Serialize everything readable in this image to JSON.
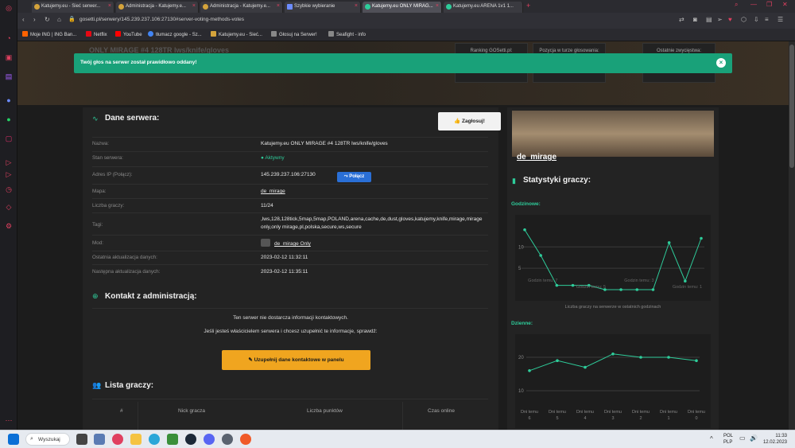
{
  "tabs": [
    {
      "label": "Katujemy.eu - Sieć serwer...",
      "active": false
    },
    {
      "label": "Administracja - Katujemy.e...",
      "active": false
    },
    {
      "label": "Administracja - Katujemy.e...",
      "active": false
    },
    {
      "label": "Szybkie wybieranie",
      "active": false
    },
    {
      "label": "Katujemy.eu ONLY MIRAG...",
      "active": true
    },
    {
      "label": "Katujemy.eu ARENA 1v1 1...",
      "active": false
    }
  ],
  "address": {
    "url": "gosetti.pl/serwery/145.239.237.106:27130#server-voting-methods-votes"
  },
  "bookmarks": [
    {
      "label": "Moje ING | ING Ban...",
      "color": "#ff6200"
    },
    {
      "label": "Netflix",
      "color": "#e50914"
    },
    {
      "label": "YouTube",
      "color": "#ff0000"
    },
    {
      "label": "tłumacz google - Sz...",
      "color": "#4285f4"
    },
    {
      "label": "Katujemy.eu - Sieć...",
      "color": "#d4a33b"
    },
    {
      "label": "Głosuj na Serwer!",
      "color": "#888888"
    },
    {
      "label": "Seafight - info",
      "color": "#888888"
    }
  ],
  "hero": {
    "title": "ONLY MIRAGE #4 128TR lws/knife/gloves",
    "boxes": [
      "Ranking GOSetti.pl:",
      "Pozycja w turze głosowania:",
      "Ostatnie zwycięstwa:"
    ]
  },
  "alert": {
    "text": "Twój głos na serwer został prawidłowo oddany!"
  },
  "server": {
    "section_title": "Dane serwera:",
    "vote_label": "Zagłosuj!",
    "connect_label": "Połącz",
    "rows": [
      {
        "label": "Nazwa:",
        "value": "Katujemy.eu ONLY MIRAGE #4 128TR lws/knife/gloves"
      },
      {
        "label": "Stan serwera:",
        "value": "Aktywny"
      },
      {
        "label": "Adres IP (Połącz):",
        "value": "145.239.237.106:27130"
      },
      {
        "label": "Mapa:",
        "value": "de_mirage"
      },
      {
        "label": "Liczba graczy:",
        "value": "11/24"
      },
      {
        "label": "Tagi:",
        "value": ",lws,128,128tick,5map,5map,POLAND,arena,cache,de,dust,gloves,katujemy,knife,mirage,mirage only,only mirage,pl,polska,secure,ws,secure"
      },
      {
        "label": "Mod:",
        "value": "de_mirage Only"
      },
      {
        "label": "Ostatnia aktualizacja danych:",
        "value": "2023-02-12 11:32:11"
      },
      {
        "label": "Następna aktualizacja danych:",
        "value": "2023-02-12 11:35:11"
      }
    ]
  },
  "contact": {
    "section_title": "Kontakt z administracją:",
    "line1": "Ten serwer nie dostarcza informacji kontaktowych.",
    "line2": "Jeśli jesteś właścicielem serwera i chcesz uzupełnić te informacje, sprawdź:",
    "button": "Uzupełnij dane kontaktowe w panelu"
  },
  "players": {
    "section_title": "Lista graczy:",
    "columns": [
      "#",
      "Nick gracza",
      "Liczba punktów",
      "Czas online"
    ]
  },
  "sidebar": {
    "map_name": "de_mirage",
    "stats_title": "Statystyki graczy:",
    "hourly_label": "Godzinowe:",
    "hourly_caption": "Liczba graczy na serwerze w ostatnich godzinach",
    "daily_label": "Dzienne:"
  },
  "chart_data": [
    {
      "type": "line",
      "title": "Godzinowe:",
      "x": [
        "",
        "",
        "",
        "",
        "",
        "",
        "",
        "",
        "",
        "",
        "",
        ""
      ],
      "x_labels_printed": [
        "Godzin temu: 7",
        "Godzin temu: 5",
        "Godzin temu: 3",
        "Godzin temu: 1"
      ],
      "values": [
        14,
        8,
        1,
        1,
        1,
        0,
        0,
        0,
        0,
        11,
        2,
        12
      ],
      "yticks": [
        5,
        10
      ],
      "ylim": [
        0,
        16
      ],
      "color": "#2ecc9a"
    },
    {
      "type": "line",
      "title": "Dzienne:",
      "categories": [
        "Dni temu 6",
        "Dni temu 5",
        "Dni temu 4",
        "Dni temu 3",
        "Dni temu 2",
        "Dni temu 1",
        "Dni temu 0"
      ],
      "values": [
        16,
        19,
        17,
        21,
        20,
        20,
        19
      ],
      "yticks": [
        10,
        20
      ],
      "ylim": [
        5,
        25
      ],
      "color": "#2ecc9a"
    }
  ],
  "taskbar": {
    "search_label": "Wyszukaj",
    "lang_line1": "POL",
    "lang_line2": "PLP",
    "time": "11:33",
    "date": "12.02.2023"
  }
}
